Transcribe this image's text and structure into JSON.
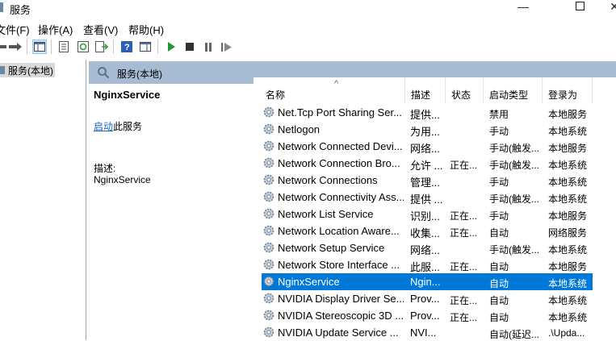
{
  "window": {
    "title": "服务"
  },
  "menu": [
    "文件(F)",
    "操作(A)",
    "查看(V)",
    "帮助(H)"
  ],
  "tree": {
    "item": "服务(本地)"
  },
  "header": {
    "label": "服务(本地)"
  },
  "description": {
    "service_name": "NginxService",
    "start_link": "启动",
    "start_suffix": "此服务",
    "desc_label": "描述:",
    "desc_value": "NginxService"
  },
  "columns": [
    "名称",
    "描述",
    "状态",
    "启动类型",
    "登录为"
  ],
  "rows": [
    {
      "name": "Net.Tcp Port Sharing Ser...",
      "desc": "提供...",
      "status": "",
      "startup": "禁用",
      "logon": "本地服务"
    },
    {
      "name": "Netlogon",
      "desc": "为用...",
      "status": "",
      "startup": "手动",
      "logon": "本地系统"
    },
    {
      "name": "Network Connected Devi...",
      "desc": "网络...",
      "status": "",
      "startup": "手动(触发...",
      "logon": "本地服务"
    },
    {
      "name": "Network Connection Bro...",
      "desc": "允许 ...",
      "status": "正在...",
      "startup": "手动(触发...",
      "logon": "本地系统"
    },
    {
      "name": "Network Connections",
      "desc": "管理...",
      "status": "",
      "startup": "手动",
      "logon": "本地系统"
    },
    {
      "name": "Network Connectivity Ass...",
      "desc": "提供 ...",
      "status": "",
      "startup": "手动(触发...",
      "logon": "本地系统"
    },
    {
      "name": "Network List Service",
      "desc": "识别...",
      "status": "正在...",
      "startup": "手动",
      "logon": "本地服务"
    },
    {
      "name": "Network Location Aware...",
      "desc": "收集...",
      "status": "正在...",
      "startup": "自动",
      "logon": "网络服务"
    },
    {
      "name": "Network Setup Service",
      "desc": "网络...",
      "status": "",
      "startup": "手动(触发...",
      "logon": "本地系统"
    },
    {
      "name": "Network Store Interface ...",
      "desc": "此服...",
      "status": "正在...",
      "startup": "自动",
      "logon": "本地服务"
    },
    {
      "name": "NginxService",
      "desc": "Ngin...",
      "status": "",
      "startup": "自动",
      "logon": "本地系统",
      "selected": true
    },
    {
      "name": "NVIDIA Display Driver Se...",
      "desc": "Prov...",
      "status": "正在...",
      "startup": "自动",
      "logon": "本地系统"
    },
    {
      "name": "NVIDIA Stereoscopic 3D ...",
      "desc": "Prov...",
      "status": "正在...",
      "startup": "自动",
      "logon": "本地系统"
    },
    {
      "name": "NVIDIA Update Service ...",
      "desc": "NVI...",
      "status": "",
      "startup": "自动(延迟...",
      "logon": ".\\Upda..."
    }
  ],
  "colors": {
    "selected": "#0078d7",
    "header_band": "#a7bcd3",
    "link": "#1565c0"
  }
}
